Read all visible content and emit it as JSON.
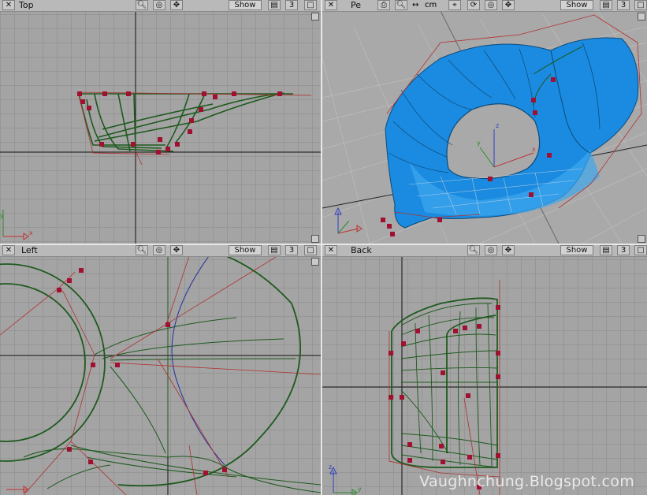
{
  "viewports": {
    "top": {
      "title": "Top",
      "show_label": "Show",
      "number": "3"
    },
    "persp": {
      "title_cut": "Pe",
      "units": "cm",
      "show_label": "Show",
      "number": "3"
    },
    "left": {
      "title": "Left",
      "show_label": "Show",
      "number": "3"
    },
    "back": {
      "title": "Back",
      "show_label": "Show",
      "number": "3"
    }
  },
  "axes": {
    "x": "x",
    "y": "y",
    "z": "z"
  },
  "watermark": "Vaughnchung.Blogspot.com",
  "colors": {
    "surface_blue": "#1a8be0",
    "curve_green": "#1e5a1e",
    "hull_red": "#b03030",
    "cv_marker": "#a01030",
    "grid": "#969696"
  }
}
